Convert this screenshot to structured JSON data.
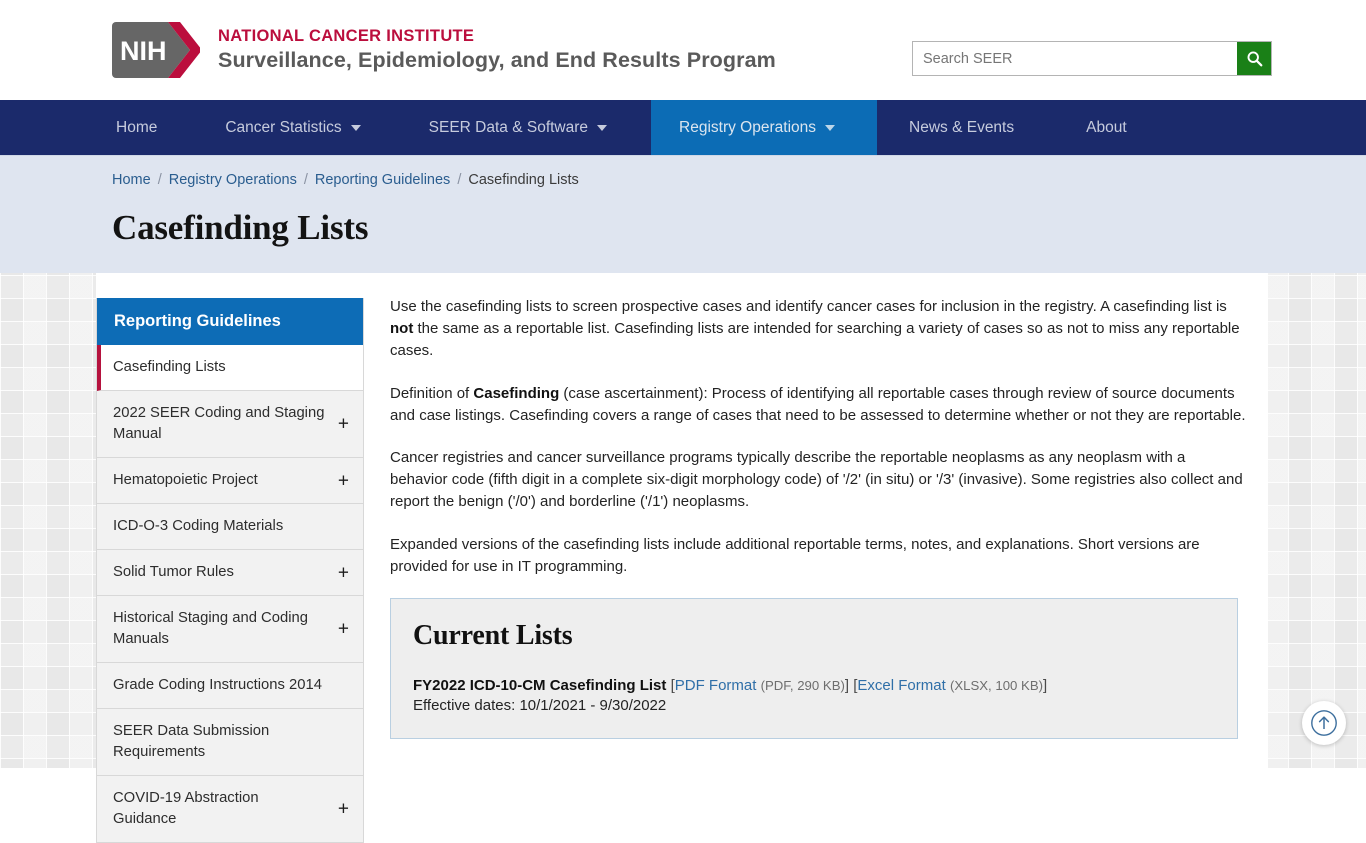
{
  "masthead": {
    "logo_alt": "NIH",
    "agency": "NATIONAL CANCER INSTITUTE",
    "program": "Surveillance, Epidemiology, and End Results Program",
    "search": {
      "placeholder": "Search SEER",
      "value": "",
      "button_label": "Search"
    },
    "brand_red": "#bb0e3d",
    "search_button_green": "#1a8017"
  },
  "mainnav": {
    "background": "#1b2a6b",
    "active_background": "#0c6cb5",
    "items": [
      {
        "label": "Home",
        "has_caret": false,
        "active": false
      },
      {
        "label": "Cancer Statistics",
        "has_caret": true,
        "active": false
      },
      {
        "label": "SEER Data & Software",
        "has_caret": true,
        "active": false
      },
      {
        "label": "Registry Operations",
        "has_caret": true,
        "active": true
      },
      {
        "label": "News & Events",
        "has_caret": false,
        "active": false
      },
      {
        "label": "About",
        "has_caret": false,
        "active": false
      }
    ]
  },
  "breadcrumb": {
    "separator": "/",
    "items": [
      {
        "label": "Home",
        "link": true
      },
      {
        "label": "Registry Operations",
        "link": true
      },
      {
        "label": "Reporting Guidelines",
        "link": true
      },
      {
        "label": "Casefinding Lists",
        "link": false
      }
    ]
  },
  "page": {
    "title": "Casefinding Lists"
  },
  "sidebar": {
    "heading": "Reporting Guidelines",
    "heading_background": "#0d6cb6",
    "active_marker_color": "#b5123e",
    "items": [
      {
        "label": "Casefinding Lists",
        "expandable": false,
        "current": true
      },
      {
        "label": "2022 SEER Coding and Staging Manual",
        "expandable": true,
        "current": false
      },
      {
        "label": "Hematopoietic Project",
        "expandable": true,
        "current": false
      },
      {
        "label": "ICD-O-3 Coding Materials",
        "expandable": false,
        "current": false
      },
      {
        "label": "Solid Tumor Rules",
        "expandable": true,
        "current": false
      },
      {
        "label": "Historical Staging and Coding Manuals",
        "expandable": true,
        "current": false
      },
      {
        "label": "Grade Coding Instructions 2014",
        "expandable": false,
        "current": false
      },
      {
        "label": "SEER Data Submission Requirements",
        "expandable": false,
        "current": false
      },
      {
        "label": "COVID-19 Abstraction Guidance",
        "expandable": true,
        "current": false
      }
    ],
    "expand_glyph": "+"
  },
  "article": {
    "paragraph_1_a": "Use the casefinding lists to screen prospective cases and identify cancer cases for inclusion in the registry. A casefinding list is ",
    "paragraph_1_bold": "not",
    "paragraph_1_b": " the same as a reportable list. Casefinding lists are intended for searching a variety of cases so as not to miss any reportable cases.",
    "paragraph_2_a": "Definition of ",
    "paragraph_2_bold": "Casefinding",
    "paragraph_2_b": " (case ascertainment): Process of identifying all reportable cases through review of source documents and case listings. Casefinding covers a range of cases that need to be assessed to determine whether or not they are reportable.",
    "paragraph_3": "Cancer registries and cancer surveillance programs typically describe the reportable neoplasms as any neoplasm with a behavior code (fifth digit in a complete six-digit morphology code) of '/2' (in situ) or '/3' (invasive). Some registries also collect and report the benign ('/0') and borderline ('/1') neoplasms.",
    "paragraph_4": "Expanded versions of the casefinding lists include additional reportable terms, notes, and explanations. Short versions are provided for use in IT programming."
  },
  "callout": {
    "heading": "Current Lists",
    "border_color": "#b9cfe1",
    "background": "#eeeeee",
    "entries": [
      {
        "title": "FY2022 ICD-10-CM Casefinding List",
        "links": [
          {
            "label": "PDF Format",
            "meta": "(PDF, 290 KB)"
          },
          {
            "label": "Excel Format",
            "meta": "(XLSX, 100 KB)"
          }
        ],
        "effective": "Effective dates: 10/1/2021 - 9/30/2022"
      }
    ],
    "bracket_open": "[",
    "bracket_close": "]"
  },
  "back_to_top": {
    "label": "Back to Top",
    "icon": "arrow-up-circle-icon",
    "color": "#3d6f9e"
  }
}
